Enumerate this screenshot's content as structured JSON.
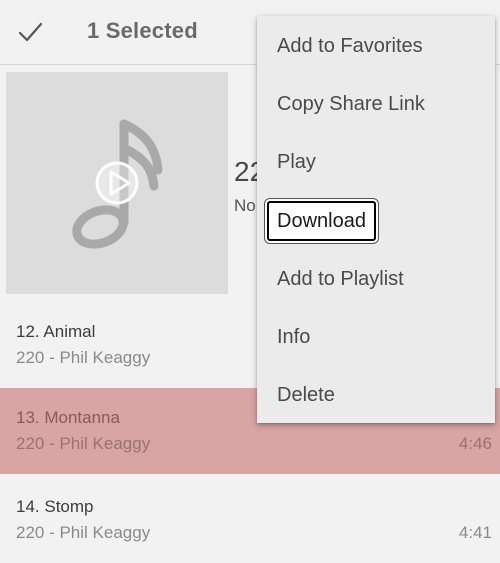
{
  "topbar": {
    "selected_label": "1 Selected"
  },
  "album": {
    "title_partial": "22",
    "subtitle_partial": "No"
  },
  "songs": [
    {
      "title": "12. Animal",
      "artist": "220 - Phil Keaggy",
      "duration": "",
      "selected": false
    },
    {
      "title": "13. Montanna",
      "artist": "220 - Phil Keaggy",
      "duration": "4:46",
      "selected": true
    },
    {
      "title": "14. Stomp",
      "artist": "220 - Phil Keaggy",
      "duration": "4:41",
      "selected": false
    }
  ],
  "menu": {
    "items": [
      {
        "label": "Add to Favorites"
      },
      {
        "label": "Copy Share Link"
      },
      {
        "label": "Play"
      },
      {
        "label": "Download"
      },
      {
        "label": "Add to Playlist"
      },
      {
        "label": "Info"
      },
      {
        "label": "Delete"
      }
    ],
    "focused_item": "Download"
  },
  "colors": {
    "background": "#f2f2f2",
    "selected_row": "#d8a4a4",
    "menu_background": "#ebebeb",
    "album_art_placeholder": "#dcdcdc"
  },
  "icons": {
    "topbar_left": "check-icon",
    "album_art": "music-note-play-icon"
  }
}
